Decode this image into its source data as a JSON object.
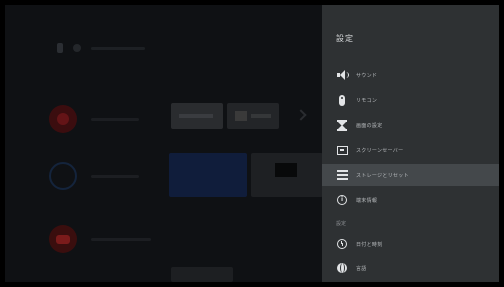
{
  "settings": {
    "title": "設定",
    "items": [
      {
        "icon": "speaker-icon",
        "label": "サウンド"
      },
      {
        "icon": "remote-icon",
        "label": "リモコン"
      },
      {
        "icon": "hourglass-icon",
        "label": "画面の設定"
      },
      {
        "icon": "screensaver-icon",
        "label": "スクリーンセーバー"
      },
      {
        "icon": "storage-icon",
        "label": "ストレージとリセット"
      },
      {
        "icon": "info-icon",
        "label": "端末情報"
      }
    ],
    "section_label": "設定",
    "section_items": [
      {
        "icon": "clock-icon",
        "label": "日付と時刻"
      },
      {
        "icon": "globe-icon",
        "label": "言語"
      }
    ],
    "selected_index": 4
  }
}
